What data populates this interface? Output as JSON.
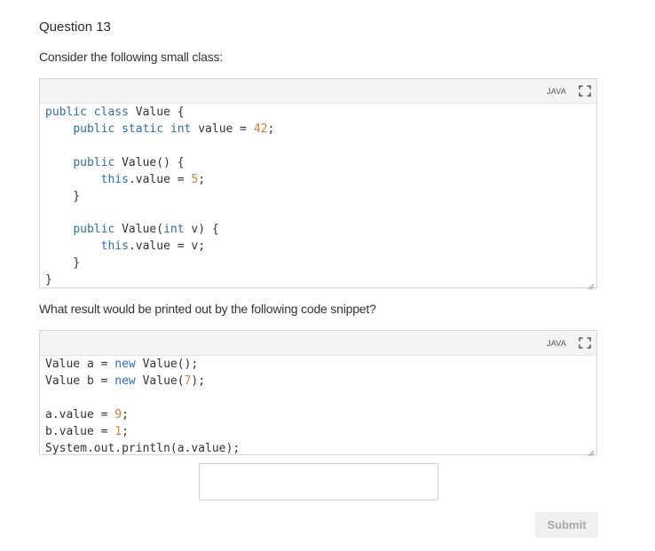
{
  "question": {
    "title": "Question 13",
    "prompt1": "Consider the following small class:",
    "prompt2": "What result would be printed out by the following code snippet?"
  },
  "code_block_1": {
    "language": "JAVA",
    "icon": "fullscreen-icon",
    "lines": [
      "public class Value {",
      "    public static int value = 42;",
      "",
      "    public Value() {",
      "        this.value = 5;",
      "    }",
      "",
      "    public Value(int v) {",
      "        this.value = v;",
      "    }",
      "}"
    ]
  },
  "code_block_2": {
    "language": "JAVA",
    "icon": "fullscreen-icon",
    "lines": [
      "Value a = new Value();",
      "Value b = new Value(7);",
      "",
      "a.value = 9;",
      "b.value = 1;",
      "System.out.println(a.value);"
    ]
  },
  "answer": {
    "value": "",
    "placeholder": ""
  },
  "submit_label": "Submit",
  "colors": {
    "keyword": "#2c6cb5",
    "number": "#e07b2a",
    "text": "#333333",
    "border": "#d6d6d6",
    "header_bg": "#f3f3f3"
  }
}
